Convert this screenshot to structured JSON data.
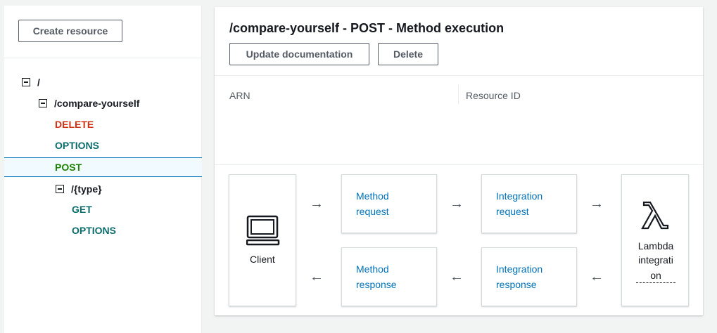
{
  "sidebar": {
    "create_resource_label": "Create resource",
    "tree": [
      {
        "type": "resource",
        "label": "/"
      },
      {
        "type": "resource",
        "label": "/compare-yourself"
      },
      {
        "type": "method",
        "label": "DELETE",
        "color": "#d13212"
      },
      {
        "type": "method",
        "label": "OPTIONS",
        "color": "#0a6b6b"
      },
      {
        "type": "method",
        "label": "POST",
        "color": "#1d8102",
        "selected": true
      },
      {
        "type": "resource",
        "label": "/{type}"
      },
      {
        "type": "method",
        "label": "GET",
        "color": "#0a6b6b"
      },
      {
        "type": "method",
        "label": "OPTIONS",
        "color": "#0a6b6b"
      }
    ]
  },
  "main": {
    "title": "/compare-yourself - POST - Method execution",
    "update_documentation_label": "Update documentation",
    "delete_label": "Delete",
    "arn_label": "ARN",
    "resource_id_label": "Resource ID"
  },
  "flow": {
    "client_label": "Client",
    "method_request": [
      "Method",
      "request"
    ],
    "integration_request": [
      "Integration",
      "request"
    ],
    "method_response": [
      "Method",
      "response"
    ],
    "integration_response": [
      "Integration",
      "response"
    ],
    "lambda_label": [
      "Lambda",
      "integrati",
      "on"
    ],
    "arrow_right": "→",
    "arrow_left": "←",
    "lambda_symbol": "λ"
  },
  "colors": {
    "link": "#0073bb",
    "delete": "#d13212",
    "options": "#0a6b6b",
    "post": "#1d8102",
    "selected_border": "#0073bb"
  }
}
